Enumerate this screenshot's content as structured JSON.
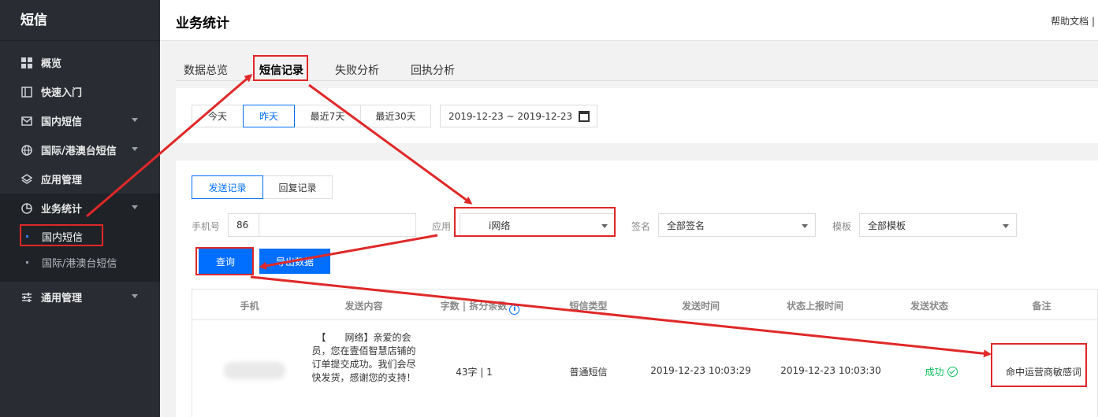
{
  "sidebar": {
    "title": "短信",
    "items": [
      {
        "label": "概览",
        "icon": "grid-icon"
      },
      {
        "label": "快速入门",
        "icon": "book-icon"
      },
      {
        "label": "国内短信",
        "icon": "mail-icon"
      },
      {
        "label": "国际/港澳台短信",
        "icon": "globe-icon"
      },
      {
        "label": "应用管理",
        "icon": "layers-icon"
      },
      {
        "label": "业务统计",
        "icon": "pie-chart-icon"
      },
      {
        "label": "通用管理",
        "icon": "sliders-icon"
      }
    ],
    "subitems": [
      {
        "label": "国内短信"
      },
      {
        "label": "国际/港澳台短信"
      }
    ]
  },
  "header": {
    "title": "业务统计",
    "help": "帮助文档 |"
  },
  "tabs": [
    "数据总览",
    "短信记录",
    "失败分析",
    "回执分析"
  ],
  "date_filter": {
    "options": [
      "今天",
      "昨天",
      "最近7天",
      "最近30天"
    ],
    "range": "2019-12-23 ~ 2019-12-23"
  },
  "record_tabs": [
    "发送记录",
    "回复记录"
  ],
  "filters": {
    "phone_label": "手机号",
    "country_code": "86",
    "app_label": "应用",
    "app_value": "i网络",
    "sign_label": "签名",
    "sign_value": "全部签名",
    "template_label": "模板",
    "template_value": "全部模板"
  },
  "buttons": {
    "query": "查询",
    "export": "导出数据"
  },
  "table": {
    "headers": [
      "手机",
      "发送内容",
      "字数 | 拆分条数",
      "短信类型",
      "发送时间",
      "状态上报时间",
      "发送状态",
      "备注"
    ],
    "info_glyph": "i",
    "rows": [
      {
        "content": "【　　网络】亲爱的会员，您在壹佰智慧店铺的订单提交成功。我们会尽快发货，感谢您的支持！",
        "count": "43字 | 1",
        "type": "普通短信",
        "send_time": "2019-12-23 10:03:29",
        "report_time": "2019-12-23 10:03:30",
        "status": "成功",
        "remark": "命中运营商敏感词"
      }
    ]
  },
  "colors": {
    "accent": "#006eff",
    "sidebar": "#292d33",
    "annotation": "#e02828",
    "success": "#0abf5b"
  }
}
